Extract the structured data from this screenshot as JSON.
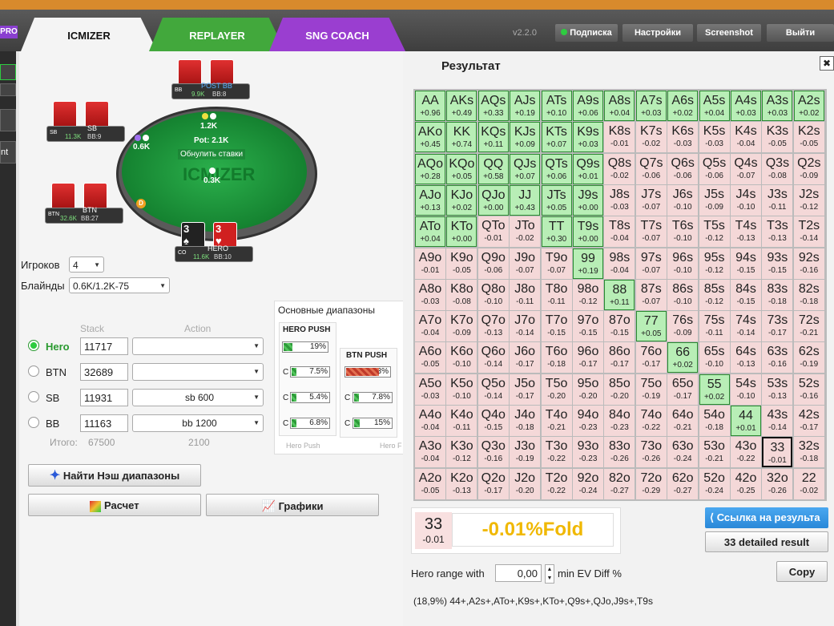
{
  "header": {
    "pro": "PRO",
    "tabs": [
      "ICMIZER",
      "REPLAYER",
      "SNG COACH"
    ],
    "version": "v2.2.0",
    "buttons": [
      "Подписка",
      "Настройки",
      "Screenshot",
      "Выйти"
    ]
  },
  "left_strip": {
    "partial_label": "nt"
  },
  "table": {
    "watermark": "ICMIZER",
    "pot": "Pot: 2.1K",
    "reset": "Обнулить ставки",
    "bets": {
      "bb": "1.2K",
      "sb": "0.6K",
      "center": "0.3K"
    },
    "dealer": "D",
    "seats": [
      {
        "id": "bb",
        "pos": "BB",
        "name": "POST BB",
        "stack": "9.9K",
        "bbs": "BB:8"
      },
      {
        "id": "sb",
        "pos": "SB",
        "name": "SB",
        "stack": "11.3K",
        "bbs": "BB:9"
      },
      {
        "id": "btn",
        "pos": "BTN",
        "name": "BTN",
        "stack": "32.6K",
        "bbs": "BB:27"
      },
      {
        "id": "hero",
        "pos": "CO",
        "name": "HERO",
        "stack": "11.6K",
        "bbs": "BB:10"
      }
    ],
    "hero_cards": [
      {
        "rank": "3",
        "suit": "♠",
        "color": "#222"
      },
      {
        "rank": "3",
        "suit": "♥",
        "color": "#d02020"
      }
    ]
  },
  "settings": {
    "players_label": "Игроков",
    "players_value": "4",
    "blinds_label": "Блайнды",
    "blinds_value": "0.6K/1.2K-75",
    "stack_header": "Stack",
    "action_header": "Action",
    "rows": [
      {
        "name": "Hero",
        "stack": "11717",
        "action": "",
        "selected": true
      },
      {
        "name": "BTN",
        "stack": "32689",
        "action": "",
        "selected": false
      },
      {
        "name": "SB",
        "stack": "11931",
        "action": "sb 600",
        "selected": false
      },
      {
        "name": "BB",
        "stack": "11163",
        "action": "bb 1200",
        "selected": false
      }
    ],
    "total_label": "Итого:",
    "total_value": "67500",
    "total_action": "2100",
    "nash_button": "Найти Нэш диапазоны",
    "calc_button": "Расчет",
    "graphs_button": "Графики"
  },
  "ranges": {
    "tab": "Основные диапазоны",
    "hero_push": {
      "title": "HERO PUSH",
      "value": "19%",
      "pct": 19
    },
    "hero_calls": [
      {
        "label": "C",
        "value": "7.5%",
        "pct": 7.5
      },
      {
        "label": "C",
        "value": "5.4%",
        "pct": 5.4
      },
      {
        "label": "C",
        "value": "6.8%",
        "pct": 6.8
      }
    ],
    "btn_push": {
      "title": "BTN PUSH",
      "value": "73%",
      "pct": 73
    },
    "btn_calls": [
      {
        "label": "C",
        "value": "7.8%",
        "pct": 7.8
      },
      {
        "label": "C",
        "value": "15%",
        "pct": 15
      }
    ],
    "footer": [
      "Hero Push",
      "Hero F"
    ]
  },
  "result": {
    "title": "Результат",
    "close": "✖",
    "grid": [
      [
        [
          "AA",
          "+0.96",
          1
        ],
        [
          "AKs",
          "+0.49",
          1
        ],
        [
          "AQs",
          "+0.33",
          1
        ],
        [
          "AJs",
          "+0.19",
          1
        ],
        [
          "ATs",
          "+0.10",
          1
        ],
        [
          "A9s",
          "+0.06",
          1
        ],
        [
          "A8s",
          "+0.04",
          1
        ],
        [
          "A7s",
          "+0.03",
          1
        ],
        [
          "A6s",
          "+0.02",
          1
        ],
        [
          "A5s",
          "+0.04",
          1
        ],
        [
          "A4s",
          "+0.03",
          1
        ],
        [
          "A3s",
          "+0.03",
          1
        ],
        [
          "A2s",
          "+0.02",
          1
        ]
      ],
      [
        [
          "AKo",
          "+0.45",
          1
        ],
        [
          "KK",
          "+0.74",
          1
        ],
        [
          "KQs",
          "+0.11",
          1
        ],
        [
          "KJs",
          "+0.09",
          1
        ],
        [
          "KTs",
          "+0.07",
          1
        ],
        [
          "K9s",
          "+0.03",
          1
        ],
        [
          "K8s",
          "-0.01",
          0
        ],
        [
          "K7s",
          "-0.02",
          0
        ],
        [
          "K6s",
          "-0.03",
          0
        ],
        [
          "K5s",
          "-0.03",
          0
        ],
        [
          "K4s",
          "-0.04",
          0
        ],
        [
          "K3s",
          "-0.05",
          0
        ],
        [
          "K2s",
          "-0.05",
          0
        ]
      ],
      [
        [
          "AQo",
          "+0.28",
          1
        ],
        [
          "KQo",
          "+0.05",
          1
        ],
        [
          "QQ",
          "+0.58",
          1
        ],
        [
          "QJs",
          "+0.07",
          1
        ],
        [
          "QTs",
          "+0.06",
          1
        ],
        [
          "Q9s",
          "+0.01",
          1
        ],
        [
          "Q8s",
          "-0.02",
          0
        ],
        [
          "Q7s",
          "-0.06",
          0
        ],
        [
          "Q6s",
          "-0.06",
          0
        ],
        [
          "Q5s",
          "-0.06",
          0
        ],
        [
          "Q4s",
          "-0.07",
          0
        ],
        [
          "Q3s",
          "-0.08",
          0
        ],
        [
          "Q2s",
          "-0.09",
          0
        ]
      ],
      [
        [
          "AJo",
          "+0.13",
          1
        ],
        [
          "KJo",
          "+0.02",
          1
        ],
        [
          "QJo",
          "+0.00",
          1
        ],
        [
          "JJ",
          "+0.43",
          1
        ],
        [
          "JTs",
          "+0.05",
          1
        ],
        [
          "J9s",
          "+0.00",
          1
        ],
        [
          "J8s",
          "-0.03",
          0
        ],
        [
          "J7s",
          "-0.07",
          0
        ],
        [
          "J6s",
          "-0.10",
          0
        ],
        [
          "J5s",
          "-0.09",
          0
        ],
        [
          "J4s",
          "-0.10",
          0
        ],
        [
          "J3s",
          "-0.11",
          0
        ],
        [
          "J2s",
          "-0.12",
          0
        ]
      ],
      [
        [
          "ATo",
          "+0.04",
          1
        ],
        [
          "KTo",
          "+0.00",
          1
        ],
        [
          "QTo",
          "-0.01",
          0
        ],
        [
          "JTo",
          "-0.02",
          0
        ],
        [
          "TT",
          "+0.30",
          1
        ],
        [
          "T9s",
          "+0.00",
          1
        ],
        [
          "T8s",
          "-0.04",
          0
        ],
        [
          "T7s",
          "-0.07",
          0
        ],
        [
          "T6s",
          "-0.10",
          0
        ],
        [
          "T5s",
          "-0.12",
          0
        ],
        [
          "T4s",
          "-0.13",
          0
        ],
        [
          "T3s",
          "-0.13",
          0
        ],
        [
          "T2s",
          "-0.14",
          0
        ]
      ],
      [
        [
          "A9o",
          "-0.01",
          0
        ],
        [
          "K9o",
          "-0.05",
          0
        ],
        [
          "Q9o",
          "-0.06",
          0
        ],
        [
          "J9o",
          "-0.07",
          0
        ],
        [
          "T9o",
          "-0.07",
          0
        ],
        [
          "99",
          "+0.19",
          1
        ],
        [
          "98s",
          "-0.04",
          0
        ],
        [
          "97s",
          "-0.07",
          0
        ],
        [
          "96s",
          "-0.10",
          0
        ],
        [
          "95s",
          "-0.12",
          0
        ],
        [
          "94s",
          "-0.15",
          0
        ],
        [
          "93s",
          "-0.15",
          0
        ],
        [
          "92s",
          "-0.16",
          0
        ]
      ],
      [
        [
          "A8o",
          "-0.03",
          0
        ],
        [
          "K8o",
          "-0.08",
          0
        ],
        [
          "Q8o",
          "-0.10",
          0
        ],
        [
          "J8o",
          "-0.11",
          0
        ],
        [
          "T8o",
          "-0.11",
          0
        ],
        [
          "98o",
          "-0.12",
          0
        ],
        [
          "88",
          "+0.11",
          1
        ],
        [
          "87s",
          "-0.07",
          0
        ],
        [
          "86s",
          "-0.10",
          0
        ],
        [
          "85s",
          "-0.12",
          0
        ],
        [
          "84s",
          "-0.15",
          0
        ],
        [
          "83s",
          "-0.18",
          0
        ],
        [
          "82s",
          "-0.18",
          0
        ]
      ],
      [
        [
          "A7o",
          "-0.04",
          0
        ],
        [
          "K7o",
          "-0.09",
          0
        ],
        [
          "Q7o",
          "-0.13",
          0
        ],
        [
          "J7o",
          "-0.14",
          0
        ],
        [
          "T7o",
          "-0.15",
          0
        ],
        [
          "97o",
          "-0.15",
          0
        ],
        [
          "87o",
          "-0.15",
          0
        ],
        [
          "77",
          "+0.05",
          1
        ],
        [
          "76s",
          "-0.09",
          0
        ],
        [
          "75s",
          "-0.11",
          0
        ],
        [
          "74s",
          "-0.14",
          0
        ],
        [
          "73s",
          "-0.17",
          0
        ],
        [
          "72s",
          "-0.21",
          0
        ]
      ],
      [
        [
          "A6o",
          "-0.05",
          0
        ],
        [
          "K6o",
          "-0.10",
          0
        ],
        [
          "Q6o",
          "-0.14",
          0
        ],
        [
          "J6o",
          "-0.17",
          0
        ],
        [
          "T6o",
          "-0.18",
          0
        ],
        [
          "96o",
          "-0.17",
          0
        ],
        [
          "86o",
          "-0.17",
          0
        ],
        [
          "76o",
          "-0.17",
          0
        ],
        [
          "66",
          "+0.02",
          1
        ],
        [
          "65s",
          "-0.10",
          0
        ],
        [
          "64s",
          "-0.13",
          0
        ],
        [
          "63s",
          "-0.16",
          0
        ],
        [
          "62s",
          "-0.19",
          0
        ]
      ],
      [
        [
          "A5o",
          "-0.03",
          0
        ],
        [
          "K5o",
          "-0.10",
          0
        ],
        [
          "Q5o",
          "-0.14",
          0
        ],
        [
          "J5o",
          "-0.17",
          0
        ],
        [
          "T5o",
          "-0.20",
          0
        ],
        [
          "95o",
          "-0.20",
          0
        ],
        [
          "85o",
          "-0.20",
          0
        ],
        [
          "75o",
          "-0.19",
          0
        ],
        [
          "65o",
          "-0.17",
          0
        ],
        [
          "55",
          "+0.02",
          1
        ],
        [
          "54s",
          "-0.10",
          0
        ],
        [
          "53s",
          "-0.13",
          0
        ],
        [
          "52s",
          "-0.16",
          0
        ]
      ],
      [
        [
          "A4o",
          "-0.04",
          0
        ],
        [
          "K4o",
          "-0.11",
          0
        ],
        [
          "Q4o",
          "-0.15",
          0
        ],
        [
          "J4o",
          "-0.18",
          0
        ],
        [
          "T4o",
          "-0.21",
          0
        ],
        [
          "94o",
          "-0.23",
          0
        ],
        [
          "84o",
          "-0.23",
          0
        ],
        [
          "74o",
          "-0.22",
          0
        ],
        [
          "64o",
          "-0.21",
          0
        ],
        [
          "54o",
          "-0.18",
          0
        ],
        [
          "44",
          "+0.01",
          1
        ],
        [
          "43s",
          "-0.14",
          0
        ],
        [
          "42s",
          "-0.17",
          0
        ]
      ],
      [
        [
          "A3o",
          "-0.04",
          0
        ],
        [
          "K3o",
          "-0.12",
          0
        ],
        [
          "Q3o",
          "-0.16",
          0
        ],
        [
          "J3o",
          "-0.19",
          0
        ],
        [
          "T3o",
          "-0.22",
          0
        ],
        [
          "93o",
          "-0.23",
          0
        ],
        [
          "83o",
          "-0.26",
          0
        ],
        [
          "73o",
          "-0.26",
          0
        ],
        [
          "63o",
          "-0.24",
          0
        ],
        [
          "53o",
          "-0.21",
          0
        ],
        [
          "43o",
          "-0.22",
          0
        ],
        [
          "33",
          "-0.01",
          2
        ],
        [
          "32s",
          "-0.18",
          0
        ]
      ],
      [
        [
          "A2o",
          "-0.05",
          0
        ],
        [
          "K2o",
          "-0.13",
          0
        ],
        [
          "Q2o",
          "-0.17",
          0
        ],
        [
          "J2o",
          "-0.20",
          0
        ],
        [
          "T2o",
          "-0.22",
          0
        ],
        [
          "92o",
          "-0.24",
          0
        ],
        [
          "82o",
          "-0.27",
          0
        ],
        [
          "72o",
          "-0.29",
          0
        ],
        [
          "62o",
          "-0.27",
          0
        ],
        [
          "52o",
          "-0.24",
          0
        ],
        [
          "42o",
          "-0.25",
          0
        ],
        [
          "32o",
          "-0.26",
          0
        ],
        [
          "22",
          "-0.02",
          0
        ]
      ]
    ],
    "summary": {
      "hand": "33",
      "ev": "-0.01",
      "decision": "-0.01%Fold"
    },
    "share_button": "Ссылка на результа",
    "detail_button": "33 detailed result",
    "hero_range_label": "Hero range with",
    "hero_range_value": "0,00",
    "min_ev_label": "min EV Diff %",
    "copy_button": "Copy",
    "range_text": "(18,9%) 44+,A2s+,ATo+,K9s+,KTo+,Q9s+,QJo,J9s+,T9s"
  }
}
